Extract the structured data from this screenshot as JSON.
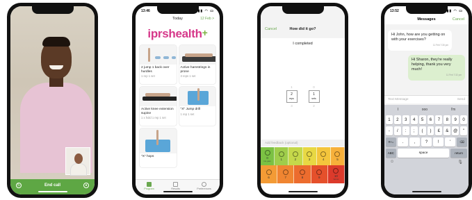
{
  "phone1": {
    "end_call_label": "End call"
  },
  "phone2": {
    "time": "13:46",
    "header_title": "Today",
    "header_date": "12 Feb >",
    "logo_text": "iprshealth",
    "logo_plus": "+",
    "cards": [
      {
        "title": "2 jump 1 back over hurdles",
        "sub": "1 rep 1 set"
      },
      {
        "title": "Active hamstrings in prone",
        "sub": "3 reps 1 set"
      },
      {
        "title": "Active knee extension supine",
        "sub": "1 x hold 1 rep 1 set"
      },
      {
        "title": "\"X\" Jump drill",
        "sub": "1 rep 1 set"
      },
      {
        "title": "\"X\" hops",
        "sub": ""
      }
    ],
    "tabs": [
      "Program",
      "Results",
      "Preferences"
    ]
  },
  "phone3": {
    "cancel_label": "Cancel",
    "title": "How did it go?",
    "question": "I completed",
    "pickers": [
      {
        "above": "1",
        "value": "2",
        "unit": "reps",
        "below": "3"
      },
      {
        "above": "0",
        "value": "1",
        "unit": "sets",
        "below": "2"
      }
    ],
    "feedback_placeholder": "Add feedback (optional)",
    "scale_top": [
      {
        "num": "0",
        "label": "No pain",
        "color": "#7bc143"
      },
      {
        "num": "1",
        "label": "",
        "color": "#9fcd4b"
      },
      {
        "num": "2",
        "label": "",
        "color": "#c5d84a"
      },
      {
        "num": "3",
        "label": "",
        "color": "#e8d843"
      },
      {
        "num": "4",
        "label": "",
        "color": "#f4c53c"
      },
      {
        "num": "5",
        "label": "",
        "color": "#f7b03a"
      }
    ],
    "scale_bottom": [
      {
        "num": "6",
        "label": "",
        "color": "#f39b35"
      },
      {
        "num": "7",
        "label": "",
        "color": "#f08531"
      },
      {
        "num": "8",
        "label": "",
        "color": "#ec6c2e"
      },
      {
        "num": "9",
        "label": "",
        "color": "#e5502b"
      },
      {
        "num": "10",
        "label": "Worst",
        "color": "#dc3a2b"
      }
    ]
  },
  "phone4": {
    "time": "13:52",
    "title": "Messages",
    "cancel_label": "Cancel",
    "messages": [
      {
        "text": "Hi John, how are you getting on with your exercises?",
        "ts": "11 Feb 7:30 pm"
      },
      {
        "text": "Hi Sharon, they're really helping, thank you very much!",
        "ts": "11 Feb 7:32 pm"
      }
    ],
    "input_placeholder": "Text Message",
    "send_label": "Send",
    "suggestions": [
      "I",
      "ooo",
      "I'm"
    ],
    "key_rows": [
      [
        "1",
        "2",
        "3",
        "4",
        "5",
        "6",
        "7",
        "8",
        "9",
        "0"
      ],
      [
        "-",
        "/",
        ":",
        ";",
        "(",
        ")",
        "£",
        "&",
        "@",
        "\""
      ],
      [
        "#+=",
        ".",
        ",",
        "?",
        "!",
        "'",
        "⌫"
      ]
    ],
    "bottom_keys": [
      "ABC",
      "space",
      "return"
    ]
  }
}
